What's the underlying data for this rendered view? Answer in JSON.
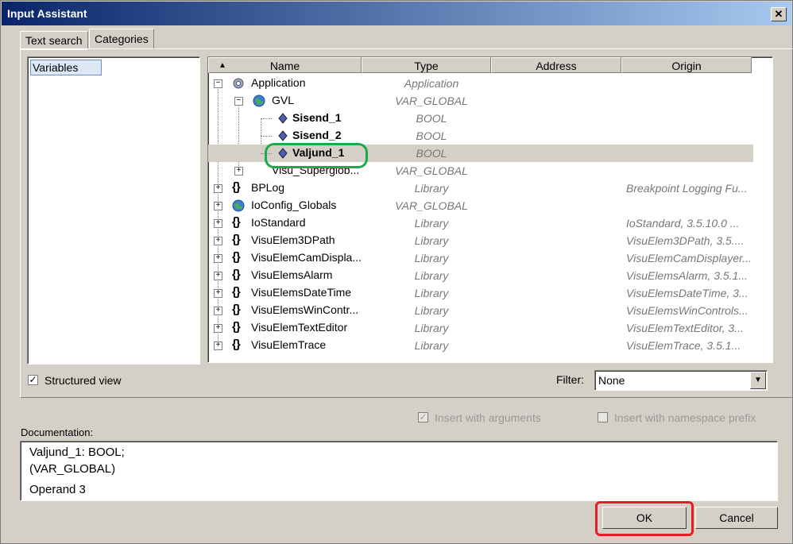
{
  "window": {
    "title": "Input Assistant",
    "close_glyph": "✕"
  },
  "tabs": [
    {
      "label": "Text search"
    },
    {
      "label": "Categories"
    }
  ],
  "categories": [
    "Variables"
  ],
  "tree": {
    "columns": [
      "Name",
      "Type",
      "Address",
      "Origin"
    ],
    "rows": [
      {
        "name": "Application",
        "type": "Application",
        "origin": ""
      },
      {
        "name": "GVL",
        "type": "VAR_GLOBAL",
        "origin": ""
      },
      {
        "name": "Sisend_1",
        "type": "BOOL",
        "origin": ""
      },
      {
        "name": "Sisend_2",
        "type": "BOOL",
        "origin": ""
      },
      {
        "name": "Valjund_1",
        "type": "BOOL",
        "origin": ""
      },
      {
        "name": "Visu_Superglob...",
        "type": "VAR_GLOBAL",
        "origin": ""
      },
      {
        "name": "BPLog",
        "type": "Library",
        "origin": "Breakpoint Logging Fu..."
      },
      {
        "name": "IoConfig_Globals",
        "type": "VAR_GLOBAL",
        "origin": ""
      },
      {
        "name": "IoStandard",
        "type": "Library",
        "origin": "IoStandard, 3.5.10.0 ..."
      },
      {
        "name": "VisuElem3DPath",
        "type": "Library",
        "origin": "VisuElem3DPath, 3.5...."
      },
      {
        "name": "VisuElemCamDispla...",
        "type": "Library",
        "origin": "VisuElemCamDisplayer..."
      },
      {
        "name": "VisuElemsAlarm",
        "type": "Library",
        "origin": "VisuElemsAlarm, 3.5.1..."
      },
      {
        "name": "VisuElemsDateTime",
        "type": "Library",
        "origin": "VisuElemsDateTime, 3..."
      },
      {
        "name": "VisuElemsWinContr...",
        "type": "Library",
        "origin": "VisuElemsWinControls..."
      },
      {
        "name": "VisuElemTextEditor",
        "type": "Library",
        "origin": "VisuElemTextEditor, 3..."
      },
      {
        "name": "VisuElemTrace",
        "type": "Library",
        "origin": "VisuElemTrace, 3.5.1..."
      }
    ]
  },
  "options": {
    "structured_view": "Structured view",
    "filter_label": "Filter:",
    "filter_value": "None",
    "insert_with_arguments": "Insert with arguments",
    "insert_with_namespace": "Insert with namespace prefix"
  },
  "documentation": {
    "label": "Documentation:",
    "line1": "Valjund_1: BOOL;",
    "line2": "(VAR_GLOBAL)",
    "line3": "Operand 3"
  },
  "buttons": {
    "ok": "OK",
    "cancel": "Cancel"
  },
  "colors": {
    "highlight_red": "#e41e25",
    "highlight_green": "#1fa94d"
  }
}
